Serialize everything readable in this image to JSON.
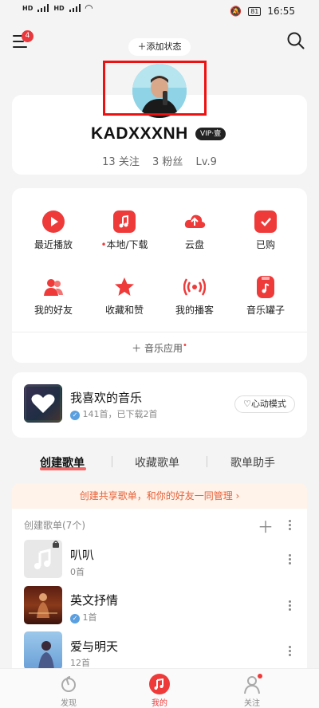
{
  "status_bar": {
    "left": [
      "HD",
      "4G",
      "HD",
      "4G"
    ],
    "time": "16:55",
    "battery": "81"
  },
  "header": {
    "menu_badge": "4",
    "add_status": "添加状态"
  },
  "profile": {
    "name": "KADXXXNH",
    "vip": "VIP·壹",
    "following": "13 关注",
    "fans": "3 粉丝",
    "level": "Lv.9"
  },
  "grid": [
    {
      "label": "最近播放",
      "icon": "play-icon"
    },
    {
      "label": "本地/下载",
      "icon": "local-music-icon",
      "dot": true
    },
    {
      "label": "云盘",
      "icon": "cloud-upload-icon"
    },
    {
      "label": "已购",
      "icon": "purchased-bag-icon"
    },
    {
      "label": "我的好友",
      "icon": "friends-icon"
    },
    {
      "label": "收藏和赞",
      "icon": "star-icon"
    },
    {
      "label": "我的播客",
      "icon": "podcast-icon"
    },
    {
      "label": "音乐罐子",
      "icon": "music-jar-icon"
    }
  ],
  "music_app": "音乐应用",
  "favorite": {
    "title": "我喜欢的音乐",
    "subtitle": "141首，已下载2首",
    "mode_button": "心动模式"
  },
  "tabs": [
    "创建歌单",
    "收藏歌单",
    "歌单助手"
  ],
  "banner": "创建共享歌单，和你的好友一同管理 ›",
  "playlist_header": "创建歌单(7个)",
  "playlists": [
    {
      "title": "叭叭",
      "count": "0首"
    },
    {
      "title": "英文抒情",
      "count": "1首"
    },
    {
      "title": "爱与明天",
      "count": "12首"
    }
  ],
  "bottom_nav": [
    "发现",
    "我的",
    "关注"
  ],
  "colors": {
    "accent": "#ef3a3a",
    "banner_text": "#e6623a"
  }
}
